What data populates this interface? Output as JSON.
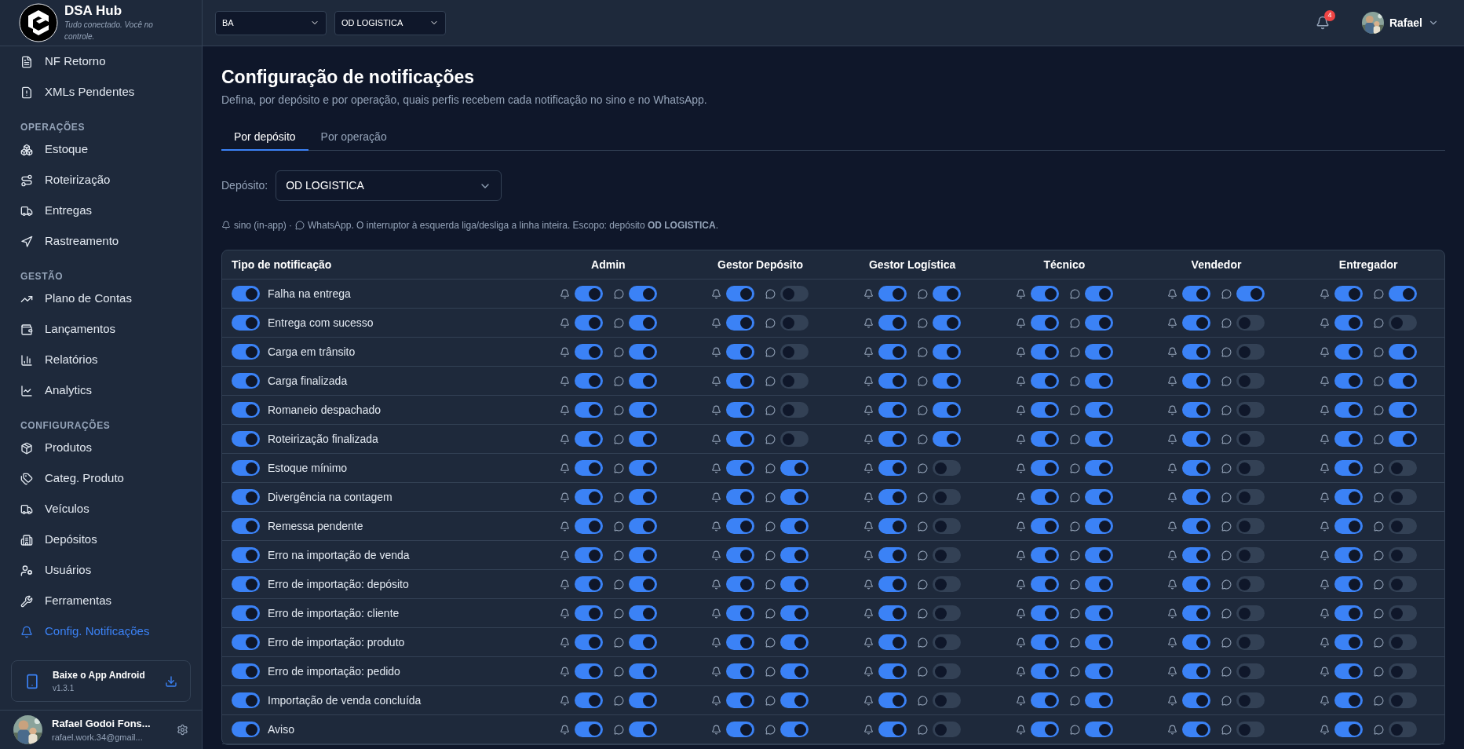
{
  "brand": {
    "name": "DSA Hub",
    "tagline": "Tudo conectado. Você no controle."
  },
  "sidebar": {
    "sections": [
      {
        "items": [
          {
            "label": "NF Retorno",
            "selected": false
          },
          {
            "label": "XMLs Pendentes",
            "selected": false
          }
        ]
      },
      {
        "heading": "OPERAÇÕES",
        "items": [
          {
            "label": "Estoque",
            "selected": false
          },
          {
            "label": "Roteirização",
            "selected": false
          },
          {
            "label": "Entregas",
            "selected": false
          },
          {
            "label": "Rastreamento",
            "selected": false
          }
        ]
      },
      {
        "heading": "GESTÃO",
        "items": [
          {
            "label": "Plano de Contas",
            "selected": false
          },
          {
            "label": "Lançamentos",
            "selected": false
          },
          {
            "label": "Relatórios",
            "selected": false
          },
          {
            "label": "Analytics",
            "selected": false
          }
        ]
      },
      {
        "heading": "CONFIGURAÇÕES",
        "items": [
          {
            "label": "Produtos",
            "selected": false
          },
          {
            "label": "Categ. Produto",
            "selected": false
          },
          {
            "label": "Veículos",
            "selected": false
          },
          {
            "label": "Depósitos",
            "selected": false
          },
          {
            "label": "Usuários",
            "selected": false
          },
          {
            "label": "Ferramentas",
            "selected": false
          },
          {
            "label": "Config. Notificações",
            "selected": true
          }
        ]
      }
    ]
  },
  "app_card": {
    "title": "Baixe o App Android",
    "version": "v1.3.1"
  },
  "user": {
    "name": "Rafael Godoi Fons...",
    "email": "rafael.work.34@gmail..."
  },
  "topbar": {
    "selects": [
      "BA",
      "OD LOGISTICA"
    ],
    "notification_count": "4",
    "user_name": "Rafael"
  },
  "page": {
    "title": "Configuração de notificações",
    "subtitle": "Defina, por depósito e por operação, quais perfis recebem cada notificação no sino e no WhatsApp."
  },
  "tabs": [
    {
      "label": "Por depósito",
      "selected": true
    },
    {
      "label": "Por operação",
      "selected": false
    }
  ],
  "deposit_filter": {
    "label": "Depósito:",
    "value": "OD LOGISTICA"
  },
  "legend": {
    "bell_text": "sino (in-app) ·",
    "whatsapp_text": "WhatsApp. O interruptor à esquerda liga/desliga a linha inteira. Escopo: depósito **OD LOGISTICA**."
  },
  "table": {
    "columns": [
      "Tipo de notificação",
      "Admin",
      "Gestor Depósito",
      "Gestor Logística",
      "Técnico",
      "Vendedor",
      "Entregador"
    ],
    "rows": [
      {
        "label": "Falha na entrega",
        "enabled": true,
        "cells": [
          {
            "bell": true,
            "whatsapp": true
          },
          {
            "bell": true,
            "whatsapp": false
          },
          {
            "bell": true,
            "whatsapp": true
          },
          {
            "bell": true,
            "whatsapp": true
          },
          {
            "bell": true,
            "whatsapp": true
          },
          {
            "bell": true,
            "whatsapp": true
          }
        ]
      },
      {
        "label": "Entrega com sucesso",
        "enabled": true,
        "cells": [
          {
            "bell": true,
            "whatsapp": true
          },
          {
            "bell": true,
            "whatsapp": false
          },
          {
            "bell": true,
            "whatsapp": true
          },
          {
            "bell": true,
            "whatsapp": true
          },
          {
            "bell": true,
            "whatsapp": false
          },
          {
            "bell": true,
            "whatsapp": false
          }
        ]
      },
      {
        "label": "Carga em trânsito",
        "enabled": true,
        "cells": [
          {
            "bell": true,
            "whatsapp": true
          },
          {
            "bell": true,
            "whatsapp": false
          },
          {
            "bell": true,
            "whatsapp": true
          },
          {
            "bell": true,
            "whatsapp": true
          },
          {
            "bell": true,
            "whatsapp": false
          },
          {
            "bell": true,
            "whatsapp": true
          }
        ]
      },
      {
        "label": "Carga finalizada",
        "enabled": true,
        "cells": [
          {
            "bell": true,
            "whatsapp": true
          },
          {
            "bell": true,
            "whatsapp": false
          },
          {
            "bell": true,
            "whatsapp": true
          },
          {
            "bell": true,
            "whatsapp": true
          },
          {
            "bell": true,
            "whatsapp": false
          },
          {
            "bell": true,
            "whatsapp": true
          }
        ]
      },
      {
        "label": "Romaneio despachado",
        "enabled": true,
        "cells": [
          {
            "bell": true,
            "whatsapp": true
          },
          {
            "bell": true,
            "whatsapp": false
          },
          {
            "bell": true,
            "whatsapp": true
          },
          {
            "bell": true,
            "whatsapp": true
          },
          {
            "bell": true,
            "whatsapp": false
          },
          {
            "bell": true,
            "whatsapp": true
          }
        ]
      },
      {
        "label": "Roteirização finalizada",
        "enabled": true,
        "cells": [
          {
            "bell": true,
            "whatsapp": true
          },
          {
            "bell": true,
            "whatsapp": false
          },
          {
            "bell": true,
            "whatsapp": true
          },
          {
            "bell": true,
            "whatsapp": true
          },
          {
            "bell": true,
            "whatsapp": false
          },
          {
            "bell": true,
            "whatsapp": true
          }
        ]
      },
      {
        "label": "Estoque mínimo",
        "enabled": true,
        "cells": [
          {
            "bell": true,
            "whatsapp": true
          },
          {
            "bell": true,
            "whatsapp": true
          },
          {
            "bell": true,
            "whatsapp": false
          },
          {
            "bell": true,
            "whatsapp": true
          },
          {
            "bell": true,
            "whatsapp": false
          },
          {
            "bell": true,
            "whatsapp": false
          }
        ]
      },
      {
        "label": "Divergência na contagem",
        "enabled": true,
        "cells": [
          {
            "bell": true,
            "whatsapp": true
          },
          {
            "bell": true,
            "whatsapp": true
          },
          {
            "bell": true,
            "whatsapp": false
          },
          {
            "bell": true,
            "whatsapp": true
          },
          {
            "bell": true,
            "whatsapp": false
          },
          {
            "bell": true,
            "whatsapp": false
          }
        ]
      },
      {
        "label": "Remessa pendente",
        "enabled": true,
        "cells": [
          {
            "bell": true,
            "whatsapp": true
          },
          {
            "bell": true,
            "whatsapp": true
          },
          {
            "bell": true,
            "whatsapp": false
          },
          {
            "bell": true,
            "whatsapp": true
          },
          {
            "bell": true,
            "whatsapp": false
          },
          {
            "bell": true,
            "whatsapp": false
          }
        ]
      },
      {
        "label": "Erro na importação de venda",
        "enabled": true,
        "cells": [
          {
            "bell": true,
            "whatsapp": true
          },
          {
            "bell": true,
            "whatsapp": true
          },
          {
            "bell": true,
            "whatsapp": false
          },
          {
            "bell": true,
            "whatsapp": true
          },
          {
            "bell": true,
            "whatsapp": false
          },
          {
            "bell": true,
            "whatsapp": false
          }
        ]
      },
      {
        "label": "Erro de importação: depósito",
        "enabled": true,
        "cells": [
          {
            "bell": true,
            "whatsapp": true
          },
          {
            "bell": true,
            "whatsapp": true
          },
          {
            "bell": true,
            "whatsapp": false
          },
          {
            "bell": true,
            "whatsapp": true
          },
          {
            "bell": true,
            "whatsapp": false
          },
          {
            "bell": true,
            "whatsapp": false
          }
        ]
      },
      {
        "label": "Erro de importação: cliente",
        "enabled": true,
        "cells": [
          {
            "bell": true,
            "whatsapp": true
          },
          {
            "bell": true,
            "whatsapp": true
          },
          {
            "bell": true,
            "whatsapp": false
          },
          {
            "bell": true,
            "whatsapp": true
          },
          {
            "bell": true,
            "whatsapp": false
          },
          {
            "bell": true,
            "whatsapp": false
          }
        ]
      },
      {
        "label": "Erro de importação: produto",
        "enabled": true,
        "cells": [
          {
            "bell": true,
            "whatsapp": true
          },
          {
            "bell": true,
            "whatsapp": true
          },
          {
            "bell": true,
            "whatsapp": false
          },
          {
            "bell": true,
            "whatsapp": true
          },
          {
            "bell": true,
            "whatsapp": false
          },
          {
            "bell": true,
            "whatsapp": false
          }
        ]
      },
      {
        "label": "Erro de importação: pedido",
        "enabled": true,
        "cells": [
          {
            "bell": true,
            "whatsapp": true
          },
          {
            "bell": true,
            "whatsapp": true
          },
          {
            "bell": true,
            "whatsapp": false
          },
          {
            "bell": true,
            "whatsapp": true
          },
          {
            "bell": true,
            "whatsapp": false
          },
          {
            "bell": true,
            "whatsapp": false
          }
        ]
      },
      {
        "label": "Importação de venda concluída",
        "enabled": true,
        "cells": [
          {
            "bell": true,
            "whatsapp": true
          },
          {
            "bell": true,
            "whatsapp": true
          },
          {
            "bell": true,
            "whatsapp": false
          },
          {
            "bell": true,
            "whatsapp": true
          },
          {
            "bell": true,
            "whatsapp": false
          },
          {
            "bell": true,
            "whatsapp": false
          }
        ]
      },
      {
        "label": "Aviso",
        "enabled": true,
        "cells": [
          {
            "bell": true,
            "whatsapp": true
          },
          {
            "bell": true,
            "whatsapp": true
          },
          {
            "bell": true,
            "whatsapp": false
          },
          {
            "bell": true,
            "whatsapp": true
          },
          {
            "bell": true,
            "whatsapp": false
          },
          {
            "bell": true,
            "whatsapp": false
          }
        ]
      }
    ]
  }
}
